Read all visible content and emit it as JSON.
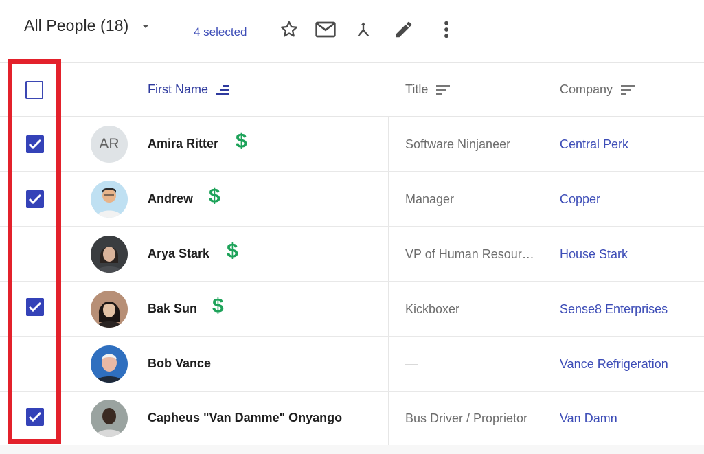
{
  "toolbar": {
    "view_title": "All People (18)",
    "selected_count": "4 selected",
    "icons": [
      "star-icon",
      "mail-icon",
      "merge-icon",
      "edit-pencil-icon",
      "more-vertical-icon"
    ]
  },
  "columns": {
    "first_name": "First Name",
    "title": "Title",
    "company": "Company"
  },
  "rows": [
    {
      "name": "Amira Ritter",
      "initials": "AR",
      "has_dollar": true,
      "title": "Software Ninjaneer",
      "company": "Central Perk",
      "checked": true
    },
    {
      "name": "Andrew",
      "has_dollar": true,
      "title": "Manager",
      "company": "Copper",
      "checked": true
    },
    {
      "name": "Arya Stark",
      "has_dollar": true,
      "title": "VP of Human Resour…",
      "company": "House Stark",
      "checked": false
    },
    {
      "name": "Bak Sun",
      "has_dollar": true,
      "title": "Kickboxer",
      "company": "Sense8 Enterprises",
      "checked": true
    },
    {
      "name": "Bob Vance",
      "has_dollar": false,
      "title": "—",
      "company": "Vance Refrigeration",
      "checked": false
    },
    {
      "name": "Capheus \"Van Damme\" Onyango",
      "has_dollar": false,
      "title": "Bus Driver / Proprietor",
      "company": "Van Damn",
      "checked": true
    }
  ],
  "dollar_symbol": "$",
  "colors": {
    "accent": "#3442b8",
    "link": "#3d4db7",
    "dollar": "#1ea35a",
    "highlight": "#e3212b"
  }
}
